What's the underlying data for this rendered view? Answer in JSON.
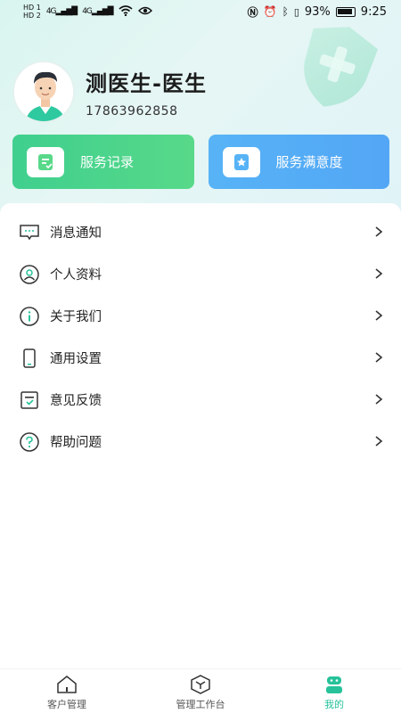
{
  "status_bar": {
    "left_tags": [
      "HD 1",
      "HD 2",
      "4G",
      "4G"
    ],
    "battery": "93%",
    "time": "9:25"
  },
  "profile": {
    "name": "测医生-医生",
    "phone": "17863962858"
  },
  "cards": [
    {
      "label": "服务记录",
      "icon": "record-icon",
      "color": "#3fcf8e"
    },
    {
      "label": "服务满意度",
      "icon": "star-card-icon",
      "color": "#57b3f6"
    }
  ],
  "menu": [
    {
      "label": "消息通知",
      "icon": "message-icon"
    },
    {
      "label": "个人资料",
      "icon": "person-icon"
    },
    {
      "label": "关于我们",
      "icon": "info-icon"
    },
    {
      "label": "通用设置",
      "icon": "phone-icon"
    },
    {
      "label": "意见反馈",
      "icon": "feedback-icon"
    },
    {
      "label": "帮助问题",
      "icon": "help-icon"
    }
  ],
  "tabbar": [
    {
      "label": "客户管理",
      "icon": "home-icon",
      "active": false
    },
    {
      "label": "管理工作台",
      "icon": "box-icon",
      "active": false
    },
    {
      "label": "我的",
      "icon": "robot-icon",
      "active": true
    }
  ],
  "colors": {
    "accent": "#27c29a",
    "card_green": "#3fcf8e",
    "card_blue": "#57b3f6"
  }
}
